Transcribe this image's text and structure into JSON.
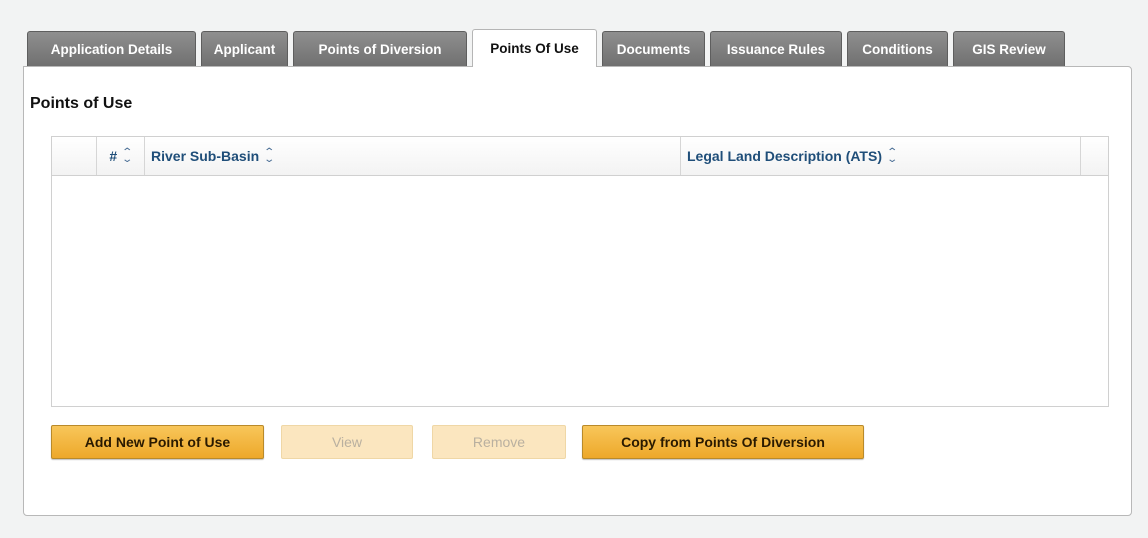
{
  "tabs": [
    {
      "label": "Application Details",
      "active": false
    },
    {
      "label": "Applicant",
      "active": false
    },
    {
      "label": "Points of Diversion",
      "active": false
    },
    {
      "label": "Points Of Use",
      "active": true
    },
    {
      "label": "Documents",
      "active": false
    },
    {
      "label": "Issuance Rules",
      "active": false
    },
    {
      "label": "Conditions",
      "active": false
    },
    {
      "label": "GIS Review",
      "active": false
    }
  ],
  "section": {
    "title": "Points of Use"
  },
  "grid": {
    "columns": [
      "#",
      "River Sub-Basin",
      "Legal Land Description (ATS)"
    ],
    "rows": []
  },
  "buttons": {
    "add": "Add New Point of Use",
    "view": "View",
    "remove": "Remove",
    "copy": "Copy from Points Of Diversion"
  },
  "icons": {
    "sort": "sort-icon"
  },
  "colors": {
    "tab_bg": "#7f7f7f",
    "button_accent": "#f0b03a",
    "header_text": "#1f4e79"
  }
}
